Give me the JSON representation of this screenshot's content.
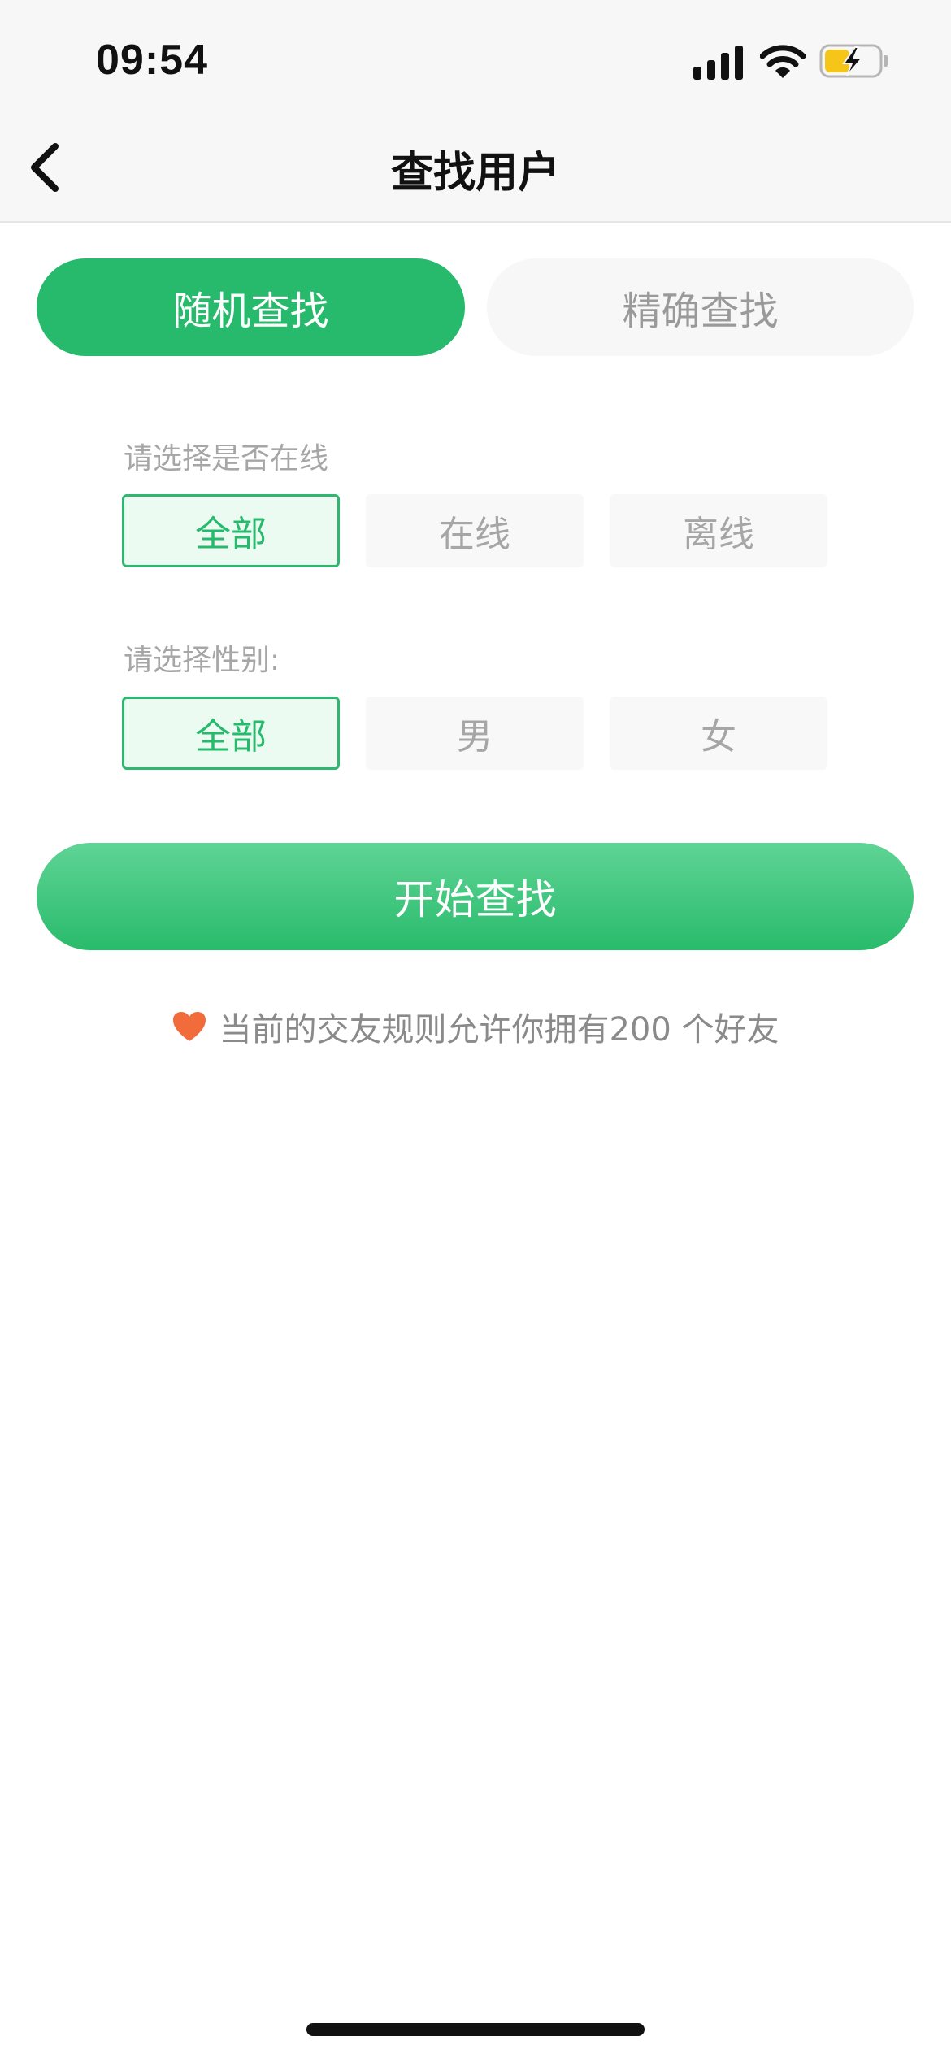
{
  "status_bar": {
    "time": "09:54",
    "icons": [
      "signal-icon",
      "wifi-icon",
      "battery-charging-icon"
    ]
  },
  "nav": {
    "title": "查找用户",
    "back_icon": "chevron-left-icon"
  },
  "tabs": [
    {
      "label": "随机查找",
      "active": true
    },
    {
      "label": "精确查找",
      "active": false
    }
  ],
  "online_filter": {
    "label": "请选择是否在线",
    "options": [
      {
        "label": "全部",
        "selected": true
      },
      {
        "label": "在线",
        "selected": false
      },
      {
        "label": "离线",
        "selected": false
      }
    ]
  },
  "gender_filter": {
    "label": "请选择性别:",
    "options": [
      {
        "label": "全部",
        "selected": true
      },
      {
        "label": "男",
        "selected": false
      },
      {
        "label": "女",
        "selected": false
      }
    ]
  },
  "start_button": {
    "label": "开始查找"
  },
  "rule_note": {
    "text": "当前的交友规则允许你拥有200 个好友",
    "icon": "heart-icon"
  },
  "colors": {
    "accent": "#27ba6c",
    "accent_light": "#ebfbf2",
    "heart": "#f26b3a",
    "muted_text": "#a6a6a6"
  }
}
